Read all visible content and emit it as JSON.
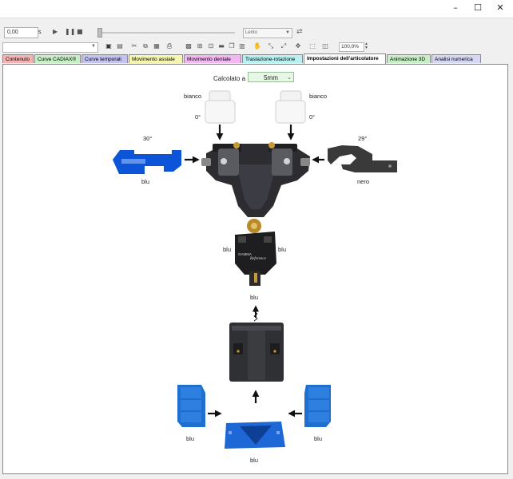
{
  "window": {
    "minimize": "–",
    "maximize": "☐",
    "close": "✕"
  },
  "playback": {
    "time": "0,00",
    "time_unit": "s",
    "speed": "Lento"
  },
  "toolbar": {
    "zoom": "100,0%"
  },
  "tabs": [
    {
      "label": "Contenuto",
      "color": "#f7b3b3"
    },
    {
      "label": "Curve CADIAX®",
      "color": "#c6efc6"
    },
    {
      "label": "Curve temporali",
      "color": "#c3c3f2"
    },
    {
      "label": "Movimento assiale",
      "color": "#f6f6b0"
    },
    {
      "label": "Movimento dentale",
      "color": "#f3b7f3"
    },
    {
      "label": "Traslazione-rotazione",
      "color": "#b7f1f1"
    },
    {
      "label": "Impostazioni dell'articolatore",
      "color": "#ffffff"
    },
    {
      "label": "Animazione 3D",
      "color": "#c6efc6"
    },
    {
      "label": "Analisi numerica",
      "color": "#d6d6f5"
    }
  ],
  "articulator": {
    "calc_label": "Calcolato a",
    "calc_value": "5mm",
    "left_top_insert": {
      "color": "bianco",
      "angle": "0°"
    },
    "right_top_insert": {
      "color": "bianco",
      "angle": "0°"
    },
    "left_side_insert": {
      "color": "blu",
      "angle": "30°"
    },
    "right_side_insert": {
      "color": "nero",
      "angle": "29°"
    },
    "lower_left_label": "blu",
    "lower_right_label": "blu",
    "pin_label": "blu",
    "bottom_left_block": "blu",
    "bottom_right_block": "blu",
    "bottom_center_block": "blu",
    "brand_text": "GAMMA",
    "model_text": "Reference"
  }
}
